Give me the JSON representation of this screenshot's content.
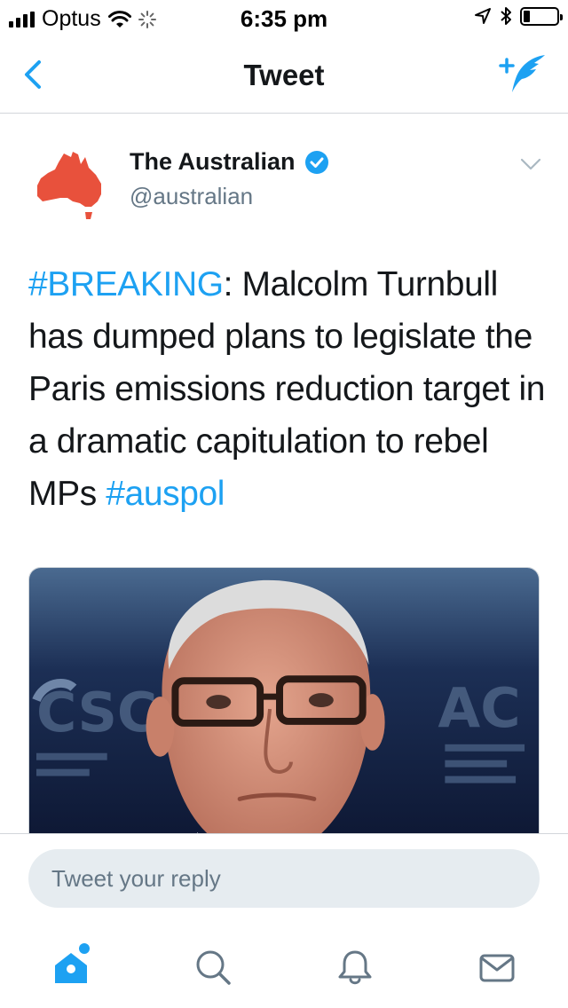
{
  "status_bar": {
    "carrier": "Optus",
    "time": "6:35 pm",
    "battery_level": 0.2
  },
  "nav": {
    "title": "Tweet",
    "back_icon": "chevron-left-icon",
    "compose_icon": "compose-tweet-icon"
  },
  "tweet": {
    "author_name": "The Australian",
    "verified": true,
    "handle": "@australian",
    "avatar_icon": "australia-map-icon",
    "text_parts": {
      "tag1": "#BREAKING",
      "body": ": Malcolm Turnbull has dumped plans to legislate the Paris emissions reduction target in a dramatic capitulation to rebel MPs ",
      "tag2": "#auspol"
    },
    "image": {
      "description_icon": "tweet-photo"
    }
  },
  "reply": {
    "placeholder": "Tweet your reply"
  },
  "tabs": [
    {
      "name": "home",
      "icon": "home-icon",
      "active": true,
      "has_notification_dot": true
    },
    {
      "name": "search",
      "icon": "search-icon",
      "active": false
    },
    {
      "name": "notifications",
      "icon": "bell-icon",
      "active": false
    },
    {
      "name": "messages",
      "icon": "mail-icon",
      "active": false
    }
  ],
  "colors": {
    "accent": "#1da1f2",
    "text": "#14171a",
    "secondary_text": "#657786",
    "avatar_red": "#e8513c",
    "reply_bg": "#e6ecf0"
  }
}
